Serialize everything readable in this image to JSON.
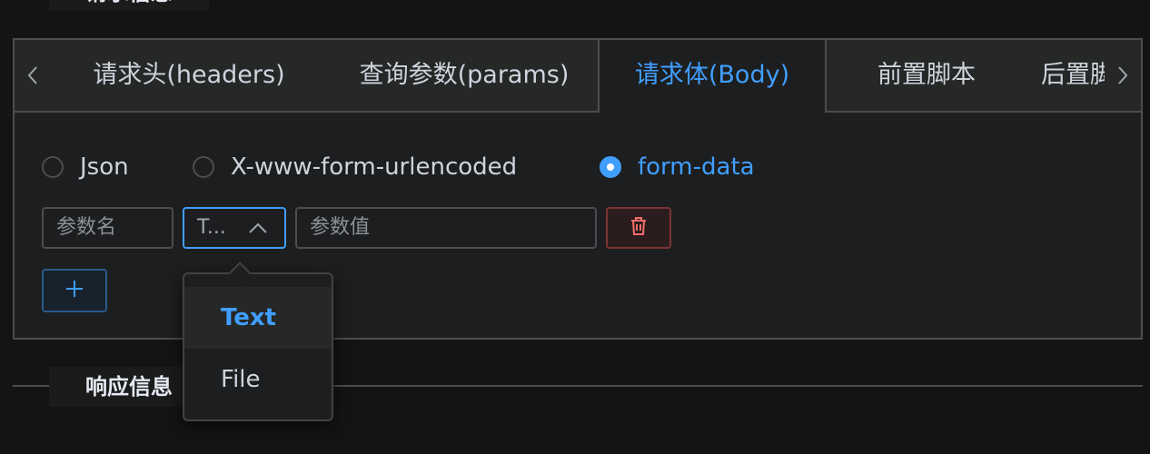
{
  "request_section": {
    "title": "请求信息"
  },
  "tabs": {
    "items": [
      {
        "label": "请求头(headers)",
        "active": false
      },
      {
        "label": "查询参数(params)",
        "active": false
      },
      {
        "label": "请求体(Body)",
        "active": true
      },
      {
        "label": "前置脚本",
        "active": false
      },
      {
        "label": "后置脚本",
        "active": false
      }
    ],
    "prev_icon": "chevron-left-icon",
    "next_icon": "chevron-right-icon"
  },
  "body_type": {
    "options": [
      {
        "label": "Json",
        "checked": false
      },
      {
        "label": "X-www-form-urlencoded",
        "checked": false
      },
      {
        "label": "form-data",
        "checked": true
      }
    ]
  },
  "form_row": {
    "name_placeholder": "参数名",
    "type_value": "T...",
    "value_placeholder": "参数值",
    "delete_icon": "trash-icon",
    "add_icon": "plus-icon"
  },
  "type_dropdown": {
    "options": [
      {
        "label": "Text",
        "selected": true
      },
      {
        "label": "File",
        "selected": false
      }
    ]
  },
  "response_section": {
    "title": "响应信息"
  },
  "colors": {
    "accent": "#409eff",
    "danger": "#f56c6c",
    "background": "#141414",
    "panel": "#1d1e1f",
    "border": "#4c4d4f"
  }
}
